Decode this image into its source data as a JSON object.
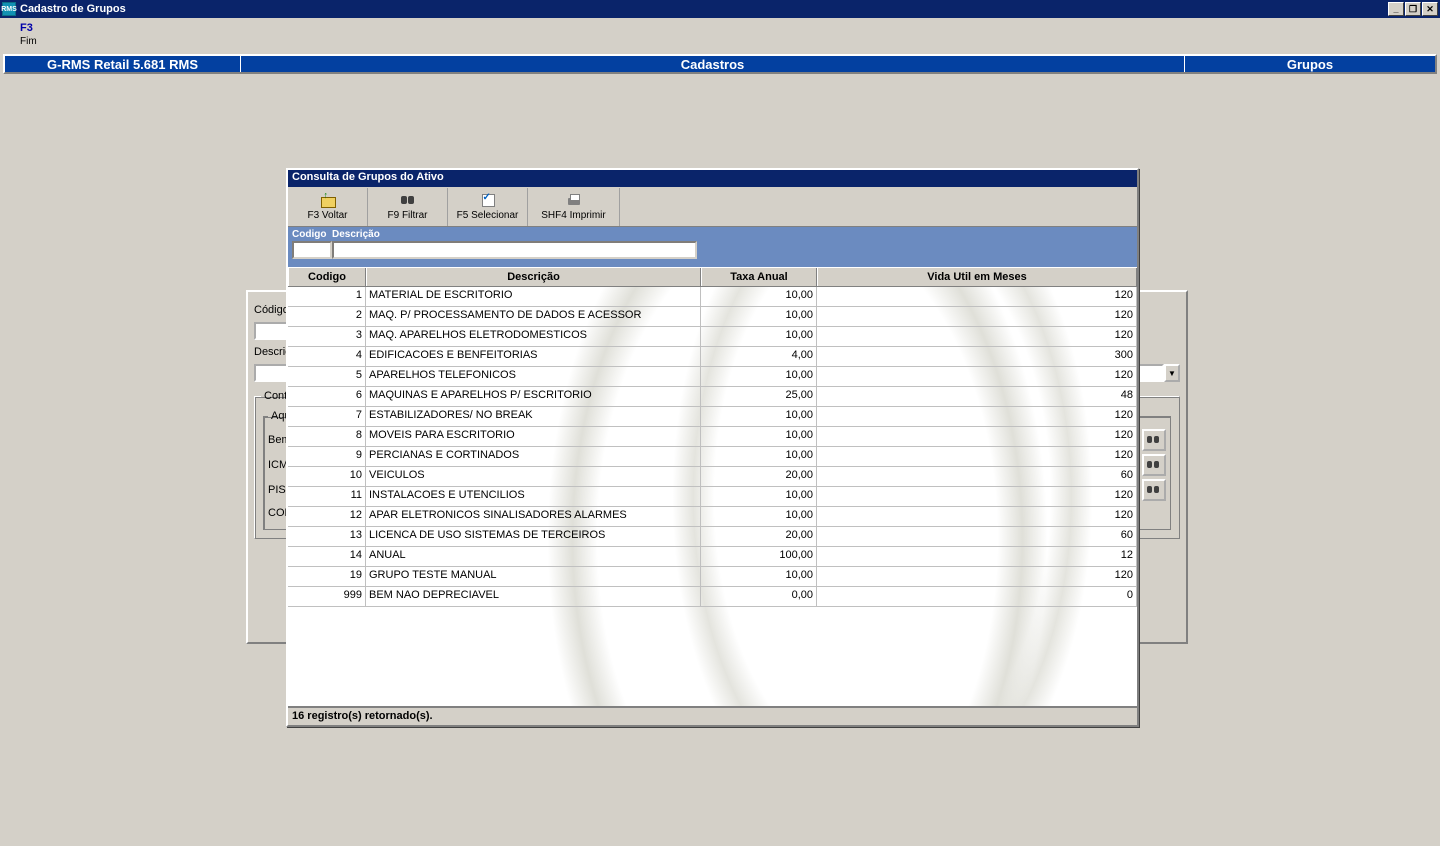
{
  "window": {
    "title": "Cadastro de Grupos"
  },
  "menu": {
    "f3": "F3",
    "fim": "Fim"
  },
  "breadcrumb": {
    "left": "G-RMS Retail 5.681 RMS",
    "center": "Cadastros",
    "right": "Grupos"
  },
  "form": {
    "codigo_label": "Código",
    "descricao_label": "Descrição",
    "contabilizacao_label": "Contabilização",
    "aquisicao_label": "Aquisição",
    "bem_label": "Bem",
    "icms_label": "ICMS",
    "pis_label": "PIS",
    "cofins_label": "COFINS"
  },
  "dialog": {
    "title": "Consulta de Grupos do Ativo",
    "toolbar": {
      "voltar": "F3 Voltar",
      "filtrar": "F9 Filtrar",
      "selecionar": "F5 Selecionar",
      "imprimir": "SHF4 Imprimir"
    },
    "filter": {
      "codigo": "Codigo",
      "descricao": "Descrição"
    },
    "columns": {
      "codigo": "Codigo",
      "descricao": "Descrição",
      "taxa": "Taxa Anual",
      "vida": "Vida Util em Meses"
    },
    "rows": [
      {
        "codigo": "1",
        "descricao": "MATERIAL DE ESCRITORIO",
        "taxa": "10,00",
        "vida": "120"
      },
      {
        "codigo": "2",
        "descricao": "MAQ. P/ PROCESSAMENTO DE DADOS E ACESSOR",
        "taxa": "10,00",
        "vida": "120"
      },
      {
        "codigo": "3",
        "descricao": "MAQ. APARELHOS ELETRODOMESTICOS",
        "taxa": "10,00",
        "vida": "120"
      },
      {
        "codigo": "4",
        "descricao": "EDIFICACOES E BENFEITORIAS",
        "taxa": "4,00",
        "vida": "300"
      },
      {
        "codigo": "5",
        "descricao": "APARELHOS TELEFONICOS",
        "taxa": "10,00",
        "vida": "120"
      },
      {
        "codigo": "6",
        "descricao": "MAQUINAS E APARELHOS P/ ESCRITORIO",
        "taxa": "25,00",
        "vida": "48"
      },
      {
        "codigo": "7",
        "descricao": "ESTABILIZADORES/ NO BREAK",
        "taxa": "10,00",
        "vida": "120"
      },
      {
        "codigo": "8",
        "descricao": "MOVEIS PARA ESCRITORIO",
        "taxa": "10,00",
        "vida": "120"
      },
      {
        "codigo": "9",
        "descricao": "PERCIANAS E CORTINADOS",
        "taxa": "10,00",
        "vida": "120"
      },
      {
        "codigo": "10",
        "descricao": "VEICULOS",
        "taxa": "20,00",
        "vida": "60"
      },
      {
        "codigo": "11",
        "descricao": "INSTALACOES E UTENCILIOS",
        "taxa": "10,00",
        "vida": "120"
      },
      {
        "codigo": "12",
        "descricao": "APAR ELETRONICOS SINALISADORES ALARMES",
        "taxa": "10,00",
        "vida": "120"
      },
      {
        "codigo": "13",
        "descricao": "LICENCA DE USO SISTEMAS DE TERCEIROS",
        "taxa": "20,00",
        "vida": "60"
      },
      {
        "codigo": "14",
        "descricao": "ANUAL",
        "taxa": "100,00",
        "vida": "12"
      },
      {
        "codigo": "19",
        "descricao": "GRUPO TESTE MANUAL",
        "taxa": "10,00",
        "vida": "120"
      },
      {
        "codigo": "999",
        "descricao": "BEM NAO DEPRECIAVEL",
        "taxa": "0,00",
        "vida": "0"
      }
    ],
    "status": "16 registro(s) retornado(s)."
  }
}
